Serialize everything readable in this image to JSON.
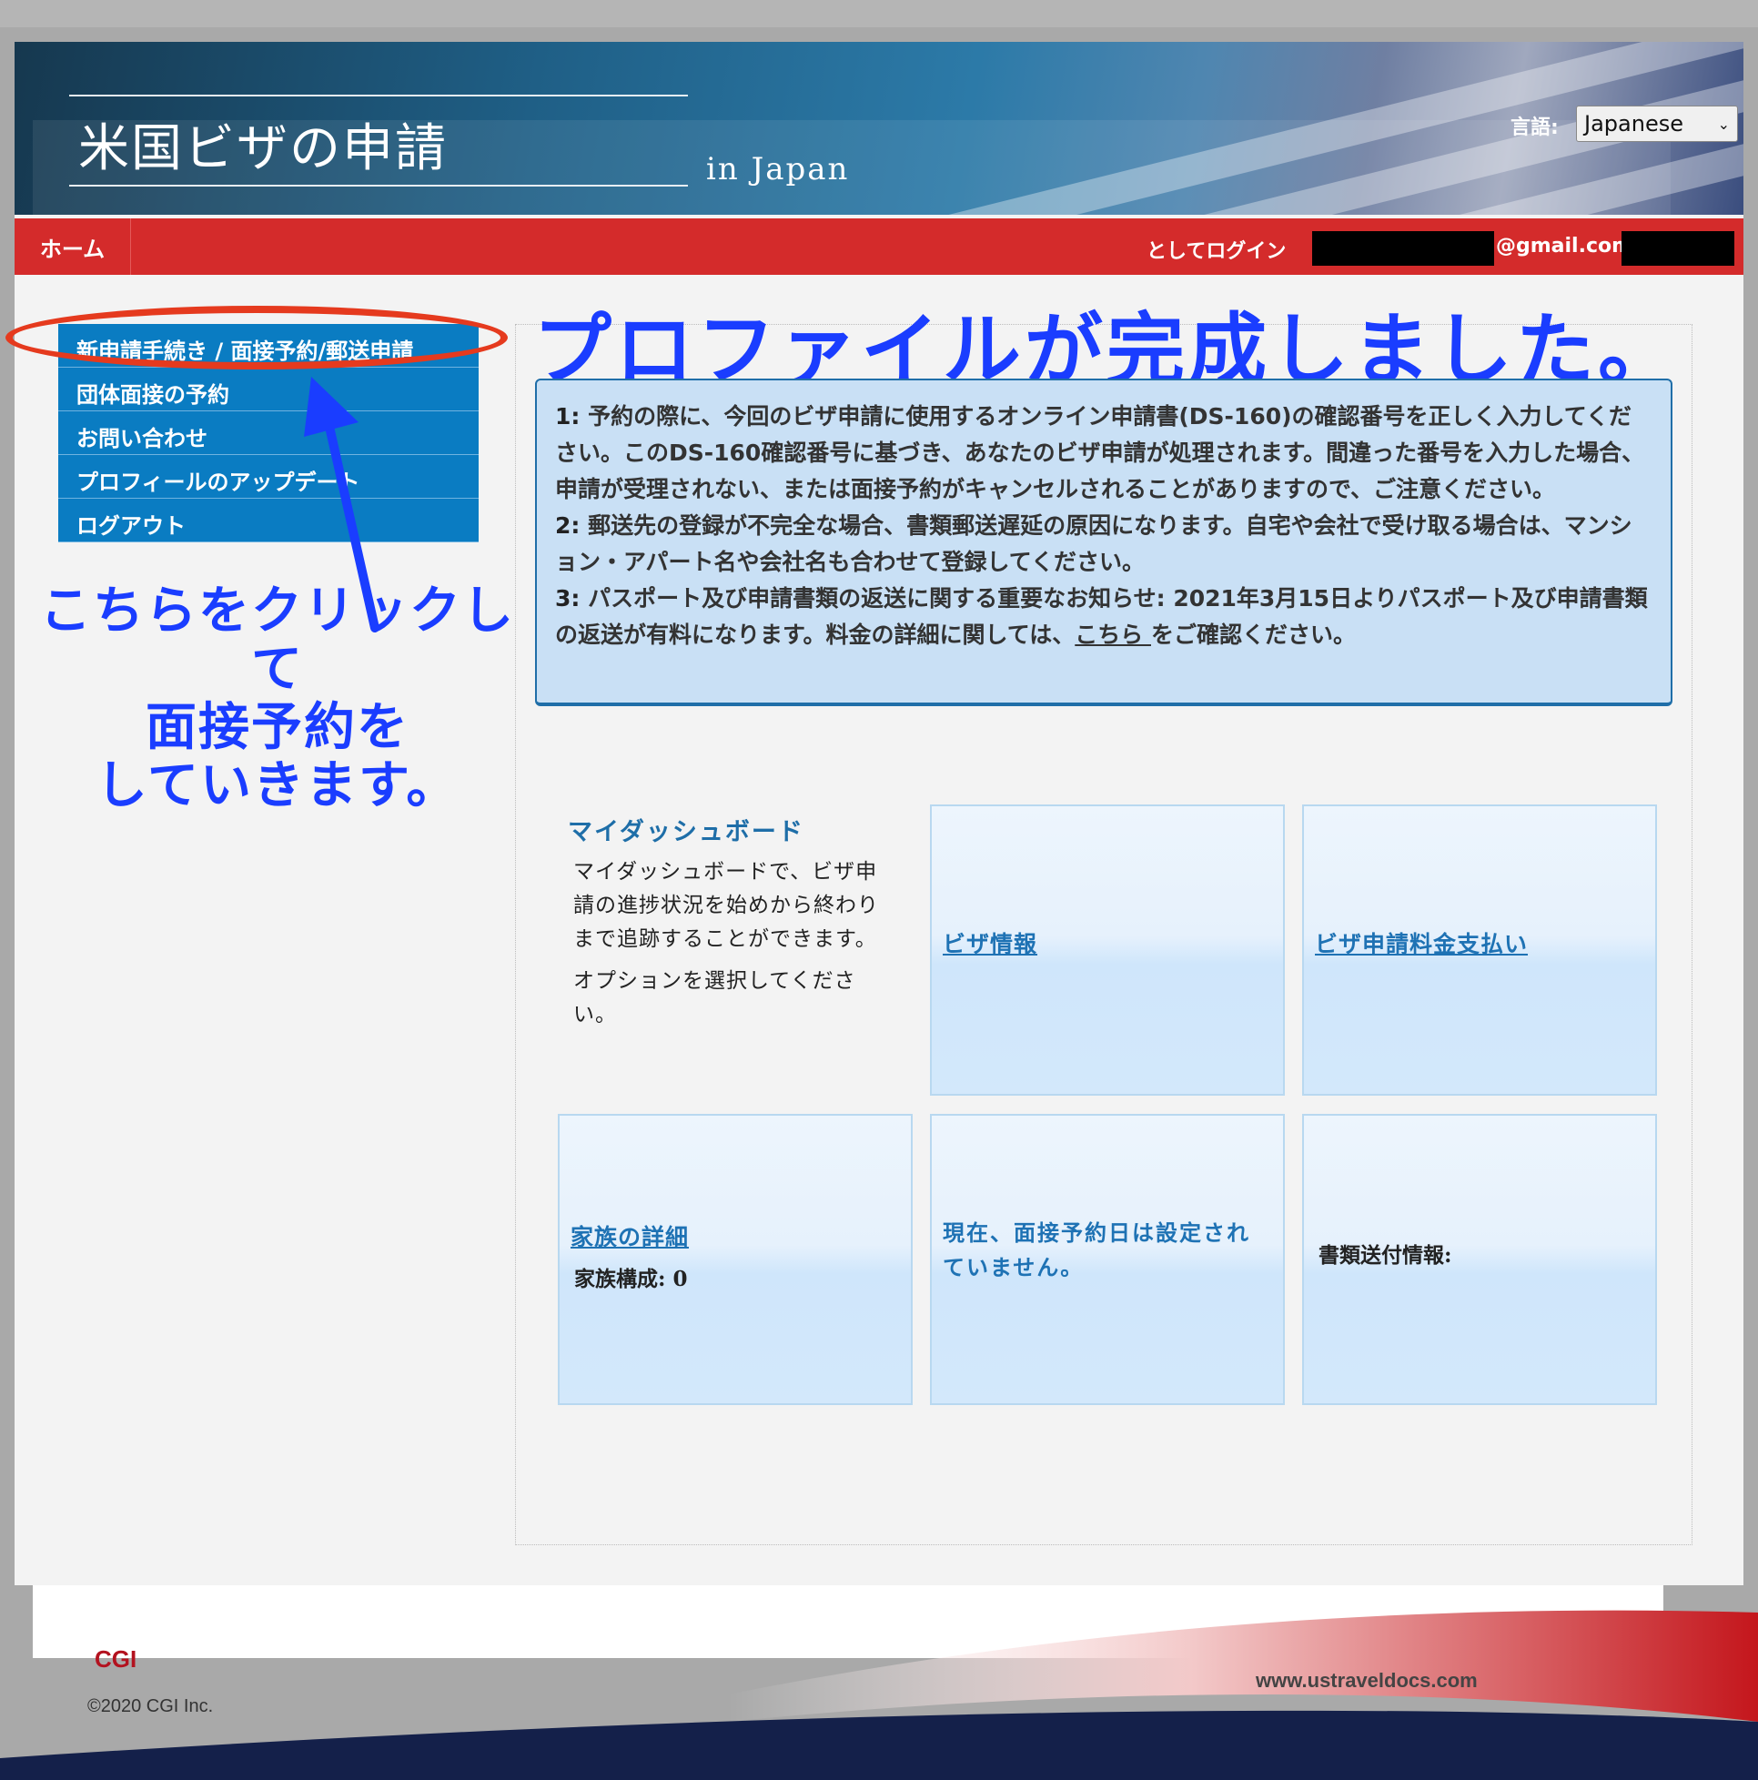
{
  "header": {
    "title": "米国ビザの申請",
    "subtitle": "in  Japan",
    "language_label": "言語:",
    "language_value": "Japanese"
  },
  "nav": {
    "home": "ホーム",
    "login_as": "としてログイン  ",
    "login_email_suffix": "@gmail.com ("
  },
  "sidebar": {
    "items": [
      {
        "label": "新申請手続き / 面接予約/郵送申請"
      },
      {
        "label": "団体面接の予約"
      },
      {
        "label": "お問い合わせ"
      },
      {
        "label": "プロフィールのアップデート"
      },
      {
        "label": "ログアウト"
      }
    ]
  },
  "annotation": {
    "heading": "プロファイルが完成しました。",
    "line1": "こちらをクリックして",
    "line2": "面接予約を",
    "line3": "していきます。"
  },
  "notice": {
    "n1": "1:",
    "t1": " 予約の際に、今回のビザ申請に使用するオンライン申請書(DS-160)の確認番号を正しく入力してください。このDS-160確認番号に基づき、あなたのビザ申請が処理されます。間違った番号を入力した場合、申請が受理されない、または面接予約がキャンセルされることがありますので、ご注意ください。",
    "n2": "2:",
    "t2": " 郵送先の登録が不完全な場合、書類郵送遅延の原因になります。自宅や会社で受け取る場合は、マンション・アパート名や会社名も合わせて登録してください。",
    "n3": "3:",
    "t3": " パスポート及び申請書類の返送に関する重要なお知らせ: 2021年3月15日よりパスポート及び申請書類の返送が有料になります。料金の詳細に関しては、",
    "link": "こちら ",
    "t3_end": "をご確認ください。"
  },
  "dashboard": {
    "title": "マイダッシュボード",
    "description": "マイダッシュボードで、ビザ申請の進捗状況を始めから終わりまで追跡することができます。",
    "option": "オプションを選択してください。",
    "tiles": {
      "visa_info": "ビザ情報",
      "visa_fee": "ビザ申請料金支払い",
      "family_details": "家族の詳細",
      "family_count": "家族構成: 0",
      "appointment": "現在、面接予約日は設定されていません。",
      "document_delivery": "書類送付情報:"
    }
  },
  "footer": {
    "logo": "CGI",
    "copyright": "©2020 CGI Inc.",
    "url": "www.ustraveldocs.com"
  },
  "colors": {
    "nav_red": "#d42b2b",
    "sidebar_blue": "#0a7cc2",
    "annotation_blue": "#1a3dff",
    "highlight_red": "#e53a1e"
  }
}
